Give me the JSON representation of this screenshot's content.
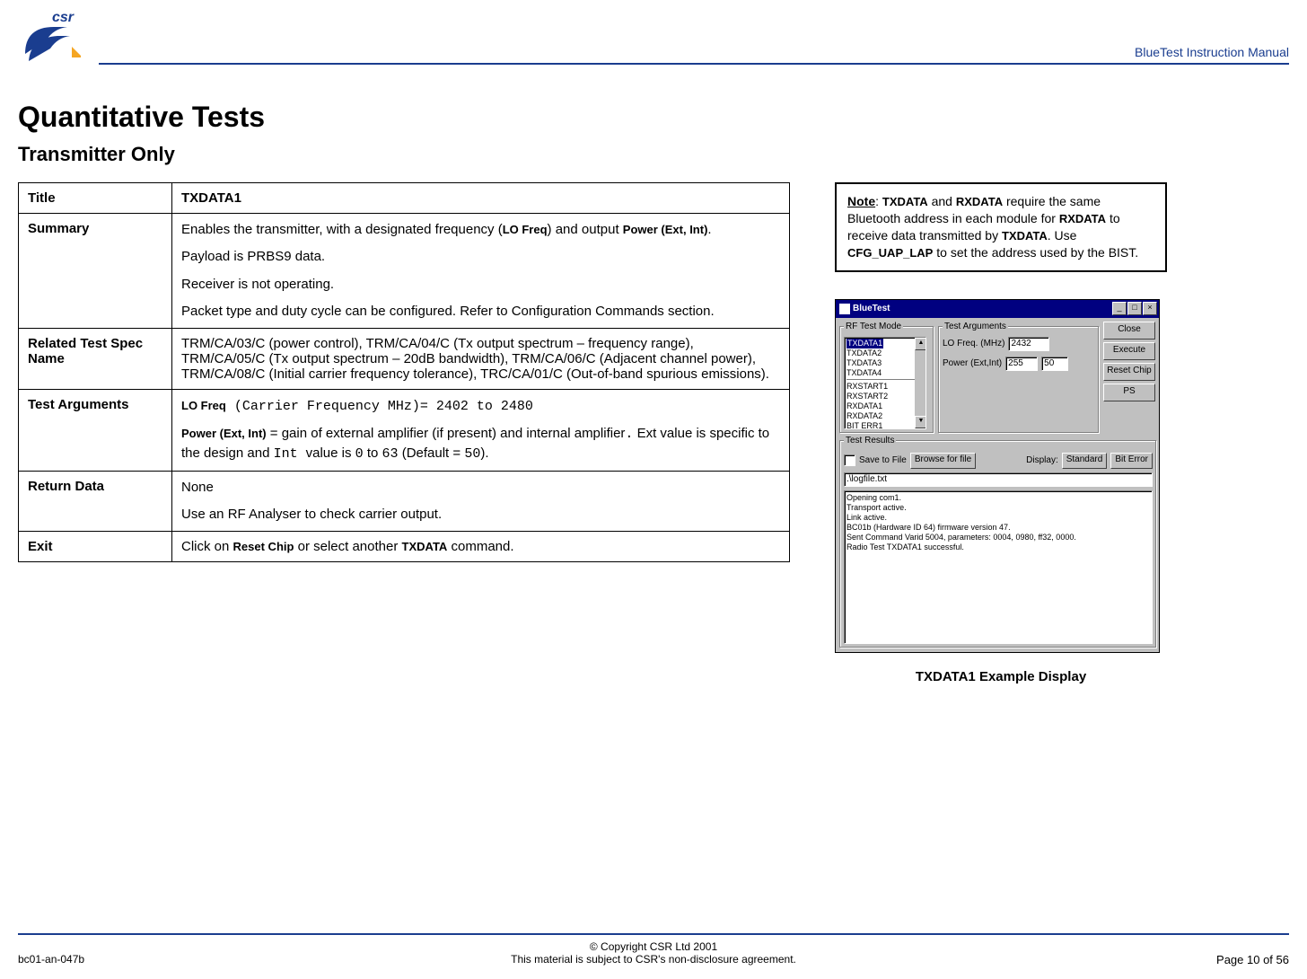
{
  "header": {
    "doc_title": "BlueTest Instruction Manual",
    "logo_text_lower": "csr"
  },
  "headings": {
    "h1": "Quantitative Tests",
    "h2": "Transmitter Only"
  },
  "table": {
    "rows": {
      "title": {
        "label": "Title",
        "value": "TXDATA1"
      },
      "summary": {
        "label": "Summary",
        "p1_pre": "Enables the transmitter, with a designated frequency  (",
        "p1_b1": "LO Freq",
        "p1_mid": ")  and output ",
        "p1_b2": "Power (Ext, Int)",
        "p1_post": ".",
        "p2": "Payload is PRBS9 data.",
        "p3": "Receiver is not operating.",
        "p4": "Packet type and duty cycle can be configured. Refer to Configuration Commands section."
      },
      "related": {
        "label": "Related Test Spec Name",
        "value": "TRM/CA/03/C (power control), TRM/CA/04/C (Tx output spectrum – frequency range), TRM/CA/05/C (Tx output spectrum – 20dB bandwidth), TRM/CA/06/C (Adjacent channel power), TRM/CA/08/C (Initial carrier frequency tolerance), TRC/CA/01/C (Out-of-band spurious emissions)."
      },
      "args": {
        "label": "Test Arguments",
        "p1_b": "LO Freq",
        "p1_mono": " (Carrier Frequency MHz)= 2402 to 2480",
        "p2_b": "Power (Ext, Int)",
        "p2_a": " = gain of external amplifier (if present) and internal amplifier",
        "p2_dot": ".",
        "p2_b2": "   Ext value is specific to the design and ",
        "p2_int": " Int ",
        "p2_c": " value is ",
        "p2_zero": "0",
        "p2_to": " to ",
        "p2_63": "63",
        "p2_def1": " (Default = ",
        "p2_50": "50",
        "p2_def2": ")."
      },
      "return": {
        "label": "Return Data",
        "p1": "None",
        "p2": "Use an RF Analyser to check carrier output."
      },
      "exit": {
        "label": "Exit",
        "pre": "Click on ",
        "b1": "Reset Chip",
        "mid": " or select another ",
        "b2": "TXDATA",
        "post": " command."
      }
    }
  },
  "note": {
    "label": "Note",
    "b1": "TXDATA",
    "t1": " and ",
    "b2": "RXDATA",
    "t2": " require the same Bluetooth address in each module for ",
    "b3": "RXDATA",
    "t3": " to receive data transmitted by ",
    "b4": "TXDATA",
    "t4": ".  Use ",
    "b5": "CFG_UAP_LAP",
    "t5": " to set the address used by the BIST."
  },
  "app": {
    "title": "BlueTest",
    "group_mode": "RF Test Mode",
    "group_args": "Test Arguments",
    "group_results": "Test Results",
    "list": {
      "selected": "TXDATA1",
      "i1": "TXDATA2",
      "i2": "TXDATA3",
      "i3": "TXDATA4",
      "i4": "RXSTART1",
      "i5": "RXSTART2",
      "i6": "RXDATA1",
      "i7": "RXDATA2",
      "i8": "BIT ERR1"
    },
    "arg1_label": "LO Freq. (MHz)",
    "arg1_value": "2432",
    "arg2_label": "Power (Ext,Int)",
    "arg2_value1": "255",
    "arg2_value2": "50",
    "buttons": {
      "close": "Close",
      "execute": "Execute",
      "reset": "Reset Chip",
      "ps": "PS"
    },
    "save_label": "Save to File",
    "browse": "Browse for file",
    "display_label": "Display:",
    "display_value": "Standard",
    "biterror": "Bit Error",
    "logfile": ".\\logfile.txt",
    "results_text": "Opening com1.\nTransport active.\nLink active.\nBC01b (Hardware ID 64) firmware version 47.\nSent Command Varid 5004, parameters: 0004, 0980, ff32, 0000.\nRadio Test TXDATA1 successful."
  },
  "caption": "TXDATA1 Example Display",
  "footer": {
    "left": "bc01-an-047b",
    "c1": "© Copyright CSR Ltd 2001",
    "c2": "This material is subject to CSR's non-disclosure agreement.",
    "right": "Page 10 of 56"
  }
}
